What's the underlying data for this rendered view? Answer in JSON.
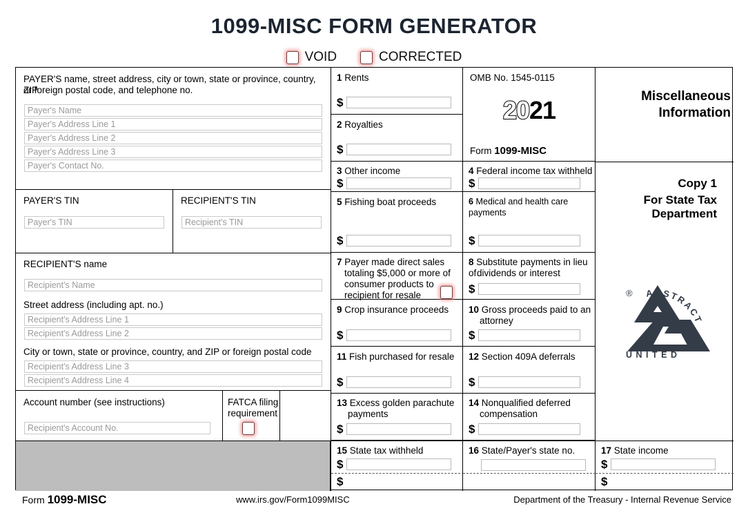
{
  "page": {
    "title": "1099-MISC FORM GENERATOR"
  },
  "top_checkboxes": [
    {
      "name": "void",
      "label": "VOID"
    },
    {
      "name": "corrected",
      "label": "CORRECTED"
    }
  ],
  "payer": {
    "heading_line1": "PAYER'S name, street address, city or town, state or province, country, ZIP",
    "heading_line2": "or foreign postal code, and telephone no.",
    "fields": [
      {
        "name": "payer-name",
        "placeholder": "Payer's Name"
      },
      {
        "name": "payer-address-1",
        "placeholder": "Payer's Address Line 1"
      },
      {
        "name": "payer-address-2",
        "placeholder": "Payer's Address Line 2"
      },
      {
        "name": "payer-address-3",
        "placeholder": "Payer's Address Line 3"
      },
      {
        "name": "payer-contact",
        "placeholder": "Payer's Contact No."
      }
    ],
    "tin_label": "PAYER'S TIN",
    "tin_placeholder": "Payer's TIN"
  },
  "recipient": {
    "tin_label": "RECIPIENT'S TIN",
    "tin_placeholder": "Recipient's TIN",
    "name_label": "RECIPIENT'S name",
    "name_placeholder": "Recipient's Name",
    "street_label": "Street address (including apt. no.)",
    "street_placeholder_1": "Recipient's Address Line 1",
    "street_placeholder_2": "Recipient's Address Line 2",
    "city_label": "City or town, state or province, country, and ZIP or foreign postal code",
    "city_placeholder_3": "Recipient's Address Line 3",
    "city_placeholder_4": "Recipient's Address Line 4",
    "account_label": "Account number (see instructions)",
    "account_placeholder": "Recipient's Account No."
  },
  "fatca": {
    "label_line1": "FATCA filing",
    "label_line2": "requirement"
  },
  "omb": {
    "number": "OMB No. 1545-0115",
    "year_hollow": "20",
    "year_solid": "21",
    "form_prefix": "Form",
    "form_name": "1099-MISC"
  },
  "right_column": {
    "title_line1": "Miscellaneous",
    "title_line2": "Information",
    "copy_line1": "Copy 1",
    "copy_line2": "For State Tax",
    "copy_line3": "Department"
  },
  "logo": {
    "registered": "®",
    "arc_text": "ABSTRACT",
    "base_text": "UNITED",
    "color": "#343c47"
  },
  "boxes": {
    "b1": {
      "num": "1",
      "label": "Rents"
    },
    "b2": {
      "num": "2",
      "label": "Royalties"
    },
    "b3": {
      "num": "3",
      "label": "Other income"
    },
    "b4": {
      "num": "4",
      "label": "Federal income tax withheld"
    },
    "b5": {
      "num": "5",
      "label": "Fishing boat proceeds"
    },
    "b6": {
      "num": "6",
      "label": "Medical and health care payments"
    },
    "b7": {
      "num": "7",
      "label_1": "Payer made direct sales",
      "label_2": "totaling $5,000 or more of",
      "label_3": "consumer products to",
      "label_4": "recipient for resale"
    },
    "b8": {
      "num": "8",
      "label_1": "Substitute payments in lieu of",
      "label_2": "dividends or interest"
    },
    "b9": {
      "num": "9",
      "label": "Crop insurance proceeds"
    },
    "b10": {
      "num": "10",
      "label_1": "Gross proceeds paid to an",
      "label_2": "attorney"
    },
    "b11": {
      "num": "11",
      "label": "Fish purchased for resale"
    },
    "b12": {
      "num": "12",
      "label": "Section 409A deferrals"
    },
    "b13": {
      "num": "13",
      "label_1": "Excess golden parachute",
      "label_2": "payments"
    },
    "b14": {
      "num": "14",
      "label_1": "Nonqualified deferred",
      "label_2": "compensation"
    },
    "b15": {
      "num": "15",
      "label": "State tax withheld"
    },
    "b16": {
      "num": "16",
      "label": "State/Payer's state no."
    },
    "b17": {
      "num": "17",
      "label": "State income"
    }
  },
  "currency_symbol": "$",
  "footer": {
    "form_prefix": "Form",
    "form_name": "1099-MISC",
    "url": "www.irs.gov/Form1099MISC",
    "agency": "Department of the Treasury - Internal Revenue Service"
  },
  "colors": {
    "title": "#1b2430",
    "glow": "#f07878",
    "gray_block": "#bdbdbd",
    "placeholder": "#9a9a9a"
  }
}
